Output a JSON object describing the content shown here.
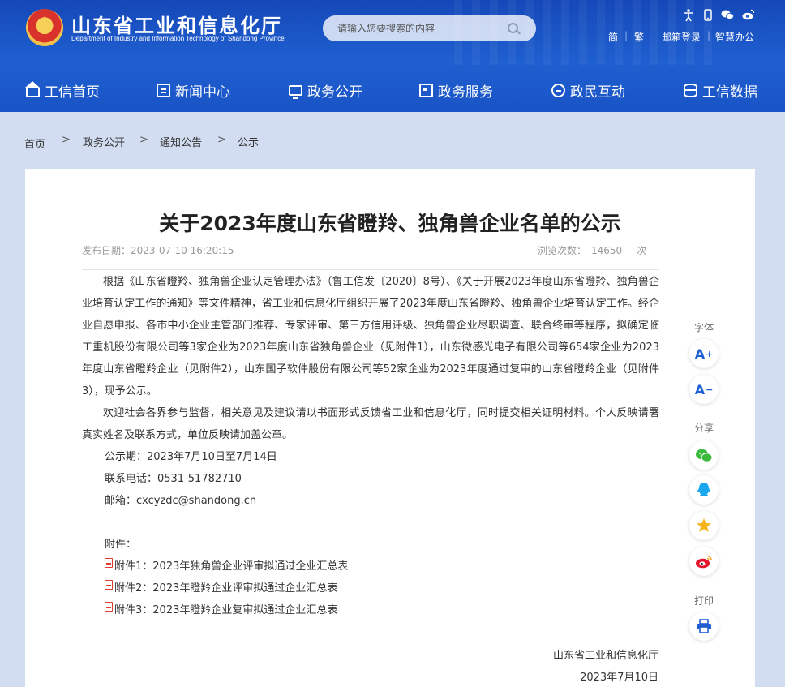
{
  "header": {
    "site_title": "山东省工业和信息化厅",
    "site_subtitle": "Department of Industry and Information Technology of Shandong Province",
    "search_placeholder": "请输入您要搜索的内容",
    "tool_icons": [
      "accessibility-icon",
      "mobile-icon",
      "wechat-icon",
      "weibo-icon"
    ],
    "links": {
      "simplified": "简",
      "separator": "|",
      "traditional": "繁",
      "mail": "邮箱登录",
      "smart_office": "智慧办公"
    }
  },
  "nav": [
    {
      "label": "工信首页",
      "icon": "home-icon"
    },
    {
      "label": "新闻中心",
      "icon": "document-icon"
    },
    {
      "label": "政务公开",
      "icon": "screen-icon"
    },
    {
      "label": "政务服务",
      "icon": "form-icon"
    },
    {
      "label": "政民互动",
      "icon": "chat-icon"
    },
    {
      "label": "工信数据",
      "icon": "database-icon"
    }
  ],
  "breadcrumb": {
    "items": [
      "首页",
      "政务公开",
      "通知公告",
      "公示"
    ],
    "separator": ">"
  },
  "article": {
    "title": "关于2023年度山东省瞪羚、独角兽企业名单的公示",
    "publish_label": "发布日期：",
    "publish_date": "2023-07-10 16:20:15",
    "views_label": "浏览次数：",
    "views": "14650",
    "views_unit": "次",
    "paragraphs": [
      "根据《山东省瞪羚、独角兽企业认定管理办法》（鲁工信发〔2020〕8号）、《关于开展2023年度山东省瞪羚、独角兽企业培育认定工作的通知》等文件精神，省工业和信息化厅组织开展了2023年度山东省瞪羚、独角兽企业培育认定工作。经企业自愿申报、各市中小企业主管部门推荐、专家评审、第三方信用评级、独角兽企业尽职调查、联合终审等程序，拟确定临工重机股份有限公司等3家企业为2023年度山东省独角兽企业（见附件1），山东微感光电子有限公司等654家企业为2023年度山东省瞪羚企业（见附件2），山东国子软件股份有限公司等52家企业为2023年度通过复审的山东省瞪羚企业（见附件3），现予公示。",
      "欢迎社会各界参与监督，相关意见及建议请以书面形式反馈省工业和信息化厅，同时提交相关证明材料。个人反映请署真实姓名及联系方式，单位反映请加盖公章。"
    ],
    "period": "公示期：2023年7月10日至7月14日",
    "phone": "联系电话：0531-51782710",
    "email": "邮箱：cxcyzdc@shandong.cn",
    "attachments_label": "附件：",
    "attachments": [
      "附件1：2023年独角兽企业评审拟通过企业汇总表",
      "附件2：2023年瞪羚企业评审拟通过企业汇总表",
      "附件3：2023年瞪羚企业复审拟通过企业汇总表"
    ],
    "signature": "山东省工业和信息化厅",
    "sign_date": "2023年7月10日"
  },
  "sidebar": {
    "font_label": "字体",
    "font_increase": "A",
    "font_increase_mark": "+",
    "font_decrease": "A",
    "font_decrease_mark": "−",
    "share_label": "分享",
    "share_icons": [
      "wechat-share-icon",
      "qq-share-icon",
      "qzone-share-icon",
      "weibo-share-icon"
    ],
    "print_label": "打印",
    "colors": {
      "wechat": "#3dbb3f",
      "qq": "#1ba7f0",
      "qzone": "#f5b41a",
      "weibo": "#e6162d"
    }
  }
}
